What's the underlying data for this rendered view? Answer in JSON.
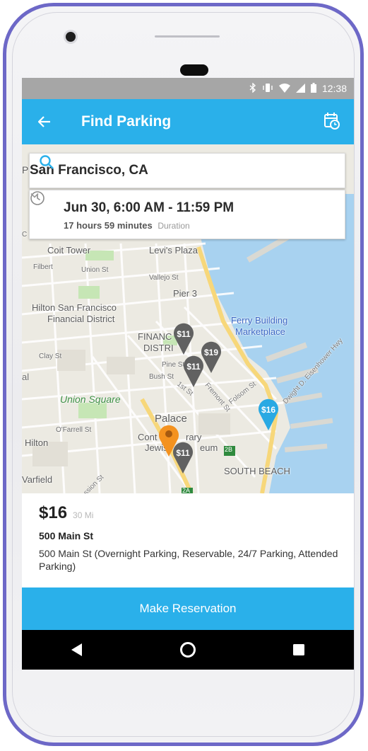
{
  "status_bar": {
    "time": "12:38",
    "icons": [
      "bluetooth-icon",
      "vibrate-icon",
      "wifi-icon",
      "signal-icon",
      "battery-icon"
    ]
  },
  "app_bar": {
    "title": "Find Parking",
    "back_icon": "arrow-left-icon",
    "action_icon": "calendar-clock-icon",
    "color": "#2ab0ea"
  },
  "search": {
    "value": "San Francisco, CA",
    "icon": "search-icon"
  },
  "time_selector": {
    "range": "Jun 30, 6:00 AM - 11:59 PM",
    "duration_value": "17 hours 59 minutes",
    "duration_label": "Duration"
  },
  "map": {
    "labels": {
      "coit_tower": "Coit Tower",
      "levis_plaza": "Levi's Plaza",
      "filbert": "Filbert",
      "union_st": "Union St",
      "vallejo_st": "Vallejo St",
      "pier_3": "Pier 3",
      "hilton_fd_1": "Hilton San Francisco",
      "hilton_fd_2": "Financial District",
      "ferry_1": "Ferry Building",
      "ferry_2": "Marketplace",
      "financial_1": "FINANC",
      "financial_2": "DISTRI",
      "clay_st": "Clay St",
      "pine_st": "Pine St",
      "bush_st": "Bush St",
      "first_st": "1st St",
      "fremont_st": "Fremont St",
      "folsom_st": "Folsom St",
      "eisenhower": "Dwight D. Eisenhower Hwy",
      "union_square": "Union Square",
      "palace": "Palace",
      "ofarrell": "O'Farrell St",
      "hilton": "Hilton",
      "contemporary_1": "Cont",
      "contemporary_2": "rary",
      "jewish_1": "Jewis",
      "jewish_2": "eum",
      "south_beach": "SOUTH BEACH",
      "warfield": "Varfield",
      "mission_st": "ssion St",
      "route_2b": "2B",
      "route_2a": "2A",
      "edge_p": "P",
      "edge_c": "C",
      "edge_al": "al"
    },
    "pins": [
      {
        "label": "$11",
        "color": "#616161"
      },
      {
        "label": "$19",
        "color": "#616161"
      },
      {
        "label": "$11",
        "color": "#616161"
      },
      {
        "label": "$16",
        "color": "#29a9e3"
      },
      {
        "label": "",
        "color": "#f4921f"
      },
      {
        "label": "$11",
        "color": "#616161"
      }
    ]
  },
  "listing": {
    "price": "$16",
    "distance": "30 Mi",
    "title": "500 Main St",
    "description": "500 Main St (Overnight Parking, Reservable, 24/7 Parking, Attended Parking)"
  },
  "reserve_button": {
    "label": "Make Reservation"
  },
  "nav": {
    "back_icon": "nav-back-icon",
    "home_icon": "nav-home-icon",
    "recents_icon": "nav-recents-icon"
  }
}
